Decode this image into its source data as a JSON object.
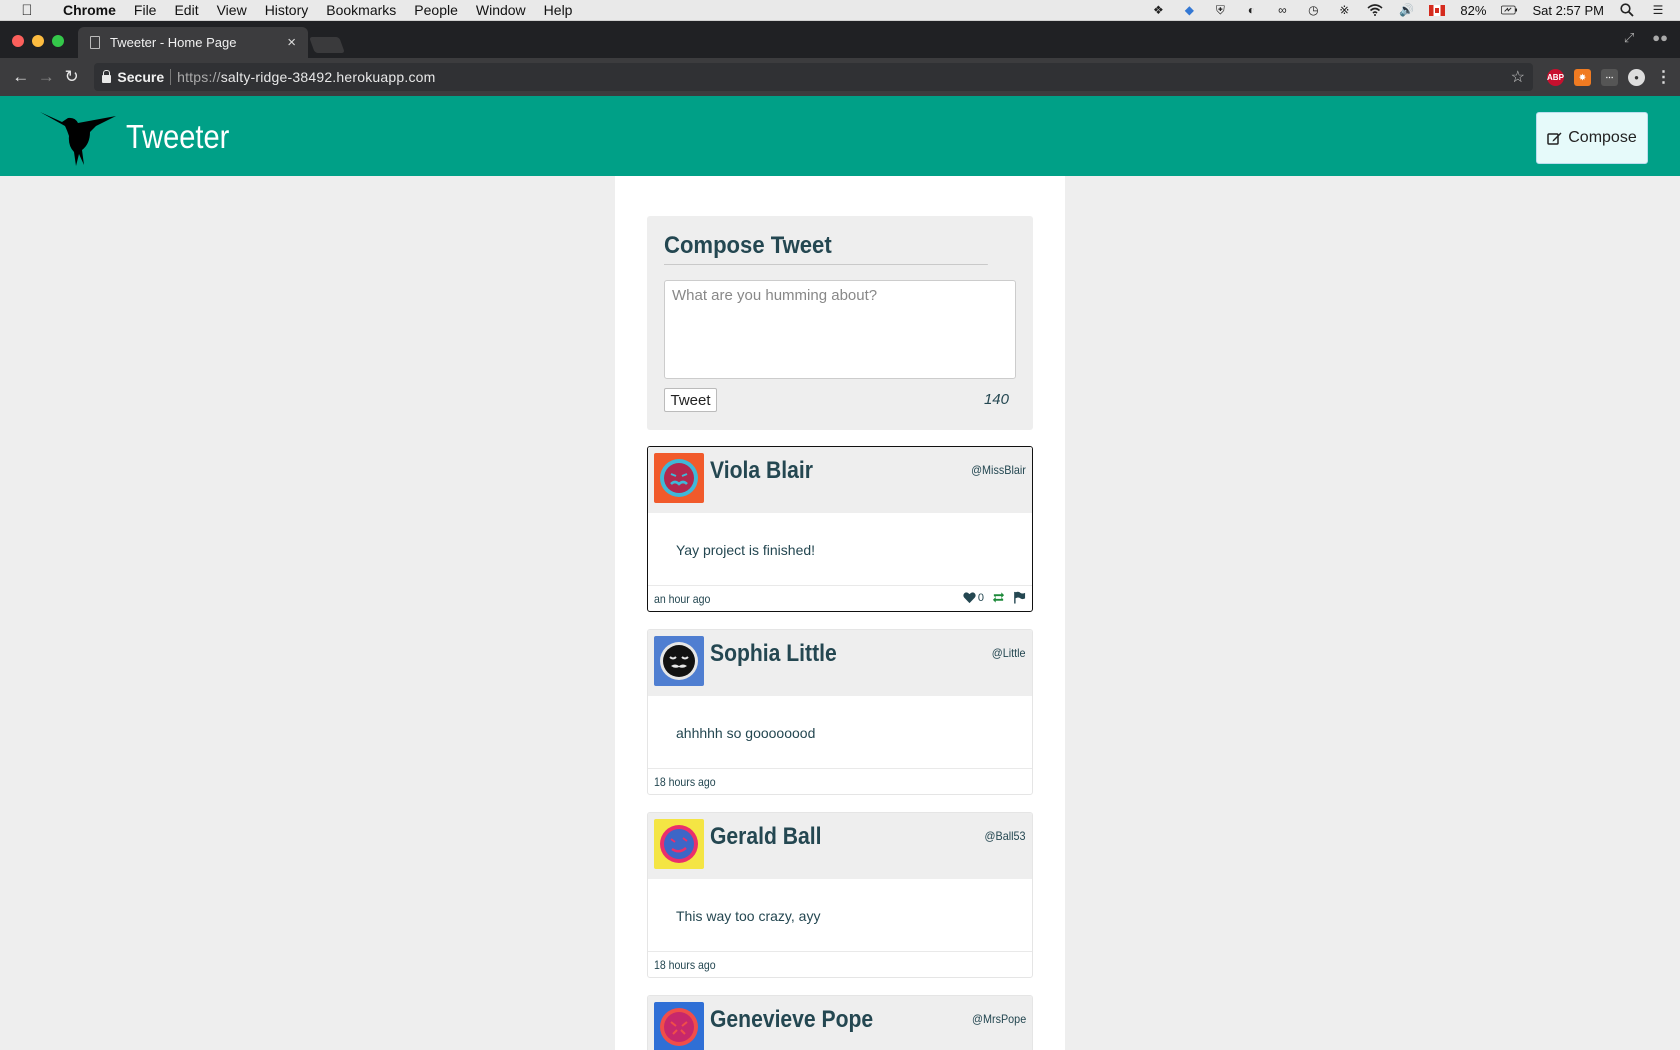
{
  "menubar": {
    "app": "Chrome",
    "items": [
      "File",
      "Edit",
      "View",
      "History",
      "Bookmarks",
      "People",
      "Window",
      "Help"
    ],
    "battery": "82%",
    "clock": "Sat 2:57 PM"
  },
  "browser": {
    "tab_title": "Tweeter - Home Page",
    "secure_label": "Secure",
    "url_scheme": "https://",
    "url_host": "salty-ridge-38492.herokuapp.com"
  },
  "header": {
    "brand": "Tweeter",
    "compose_label": "Compose",
    "accent": "#00a087"
  },
  "compose": {
    "title": "Compose Tweet",
    "placeholder": "What are you humming about?",
    "submit_label": "Tweet",
    "counter": "140"
  },
  "tweets": [
    {
      "name": "Viola Blair",
      "handle": "@MissBlair",
      "text": "Yay project is finished!",
      "time": "an hour ago",
      "likes": "0",
      "avatar_bg": "#f15a2b",
      "avatar_fg": "#3fb8d8",
      "avatar_face": "#b2274e"
    },
    {
      "name": "Sophia Little",
      "handle": "@Little",
      "text": "ahhhhh so goooooood",
      "time": "18 hours ago",
      "avatar_bg": "#4f7ed1",
      "avatar_fg": "#e6e6e6",
      "avatar_face": "#111111"
    },
    {
      "name": "Gerald Ball",
      "handle": "@Ball53",
      "text": "This way too crazy, ayy",
      "time": "18 hours ago",
      "avatar_bg": "#f4e544",
      "avatar_fg": "#ea2f6c",
      "avatar_face": "#3d66c7"
    },
    {
      "name": "Genevieve Pope",
      "handle": "@MrsPope",
      "avatar_bg": "#2f6fd6",
      "avatar_fg": "#f04e49",
      "avatar_face": "#c7286b"
    }
  ]
}
